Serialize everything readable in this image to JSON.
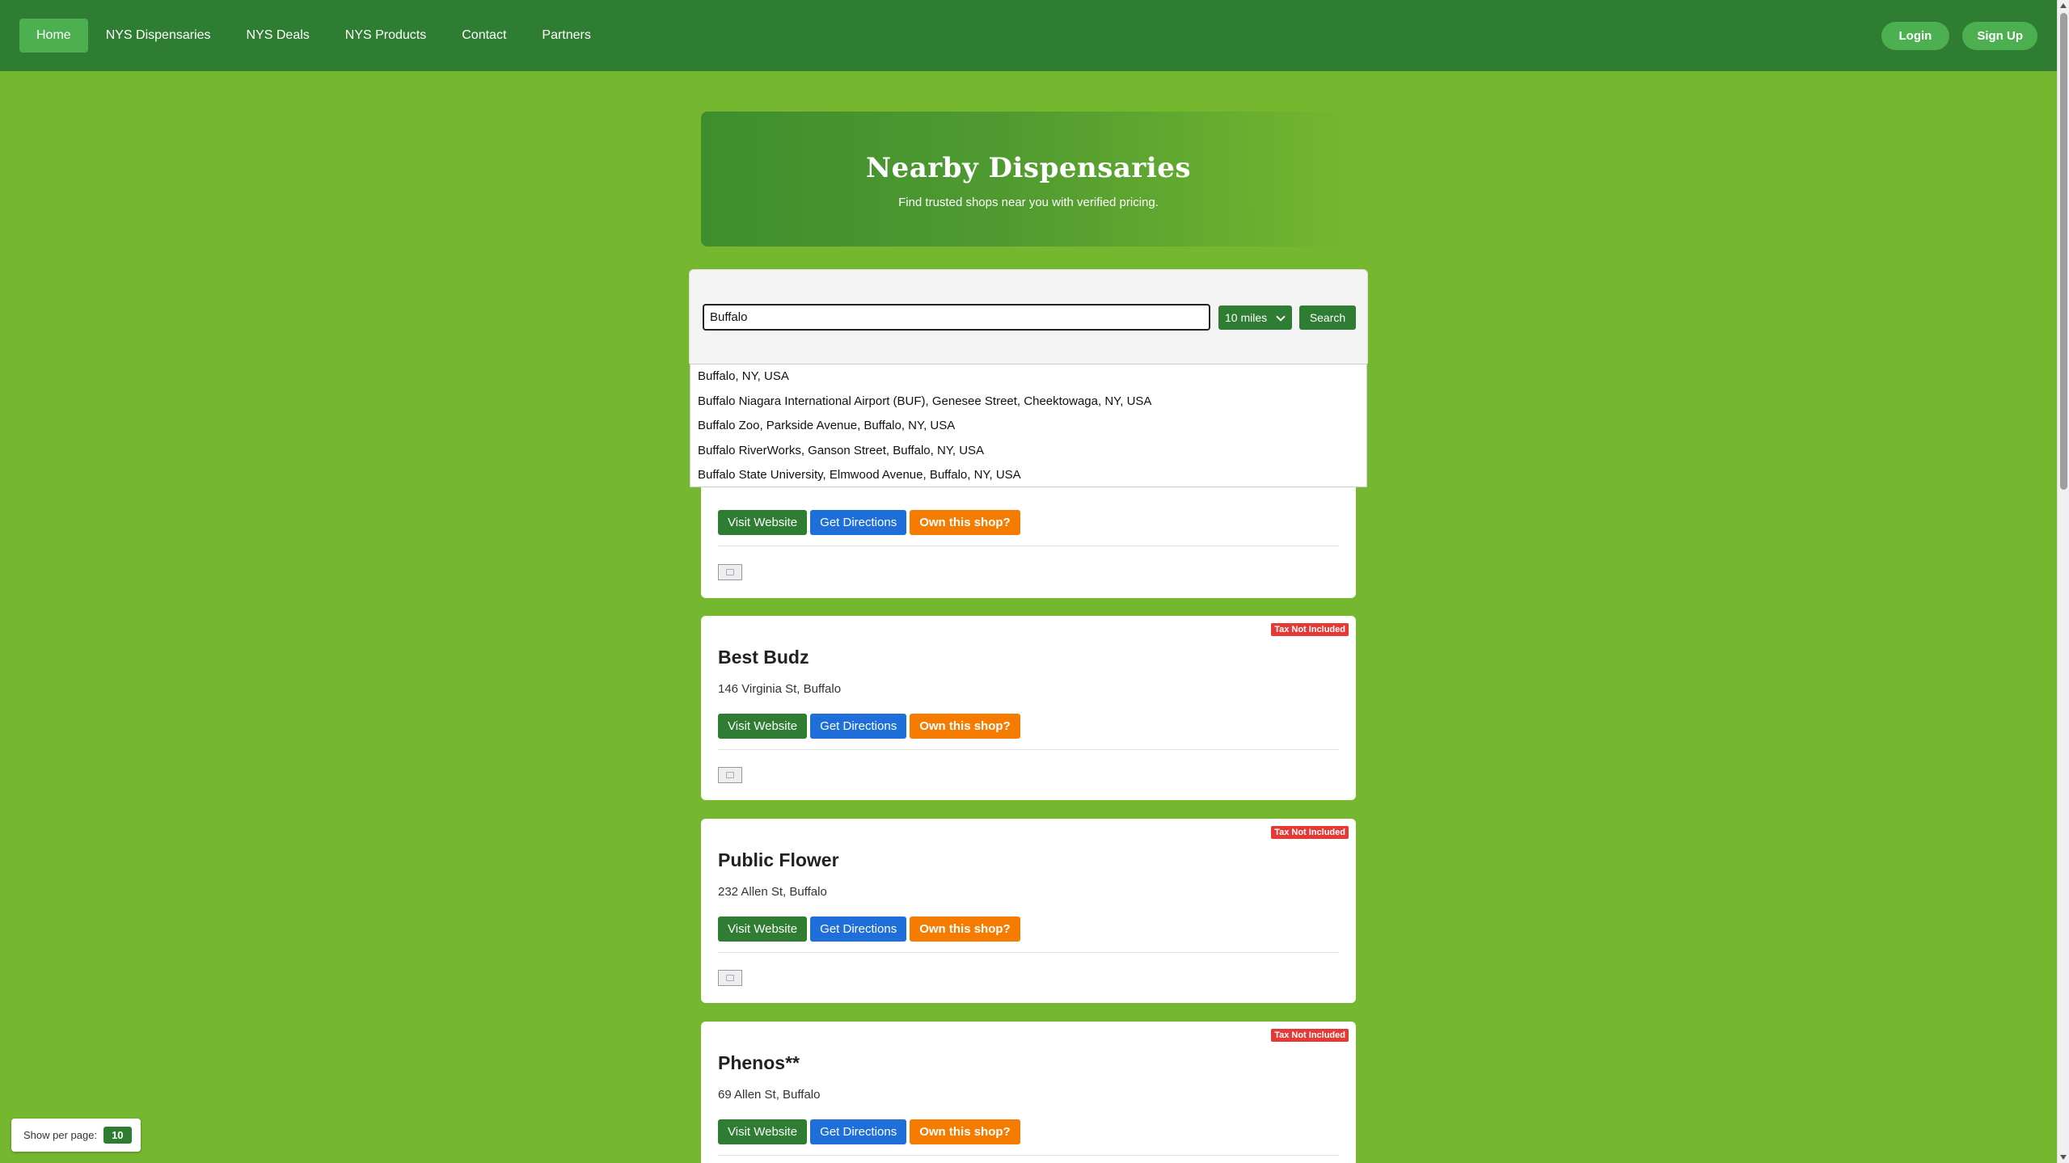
{
  "nav": {
    "items": [
      "Home",
      "NYS Dispensaries",
      "NYS Deals",
      "NYS Products",
      "Contact",
      "Partners"
    ],
    "login": "Login",
    "signup": "Sign Up"
  },
  "hero": {
    "title": "Nearby Dispensaries",
    "subtitle": "Find trusted shops near you with verified pricing."
  },
  "search": {
    "value": "Buffalo",
    "radius": "10 miles",
    "button": "Search"
  },
  "suggestions": [
    "Buffalo, NY, USA",
    "Buffalo Niagara International Airport (BUF), Genesee Street, Cheektowaga, NY, USA",
    "Buffalo Zoo, Parkside Avenue, Buffalo, NY, USA",
    "Buffalo RiverWorks, Ganson Street, Buffalo, NY, USA",
    "Buffalo State University, Elmwood Avenue, Buffalo, NY, USA"
  ],
  "card_buttons": {
    "website": "Visit Website",
    "directions": "Get Directions",
    "own": "Own this shop?"
  },
  "badge": "Tax Not Included",
  "cards": [
    {
      "name": "",
      "address": "",
      "partial": true
    },
    {
      "name": "Best Budz",
      "address": "146 Virginia St, Buffalo"
    },
    {
      "name": "Public Flower",
      "address": "232 Allen St, Buffalo"
    },
    {
      "name": "Phenos**",
      "address": "69 Allen St, Buffalo"
    }
  ],
  "perpage": {
    "label": "Show per page:",
    "value": "10"
  }
}
